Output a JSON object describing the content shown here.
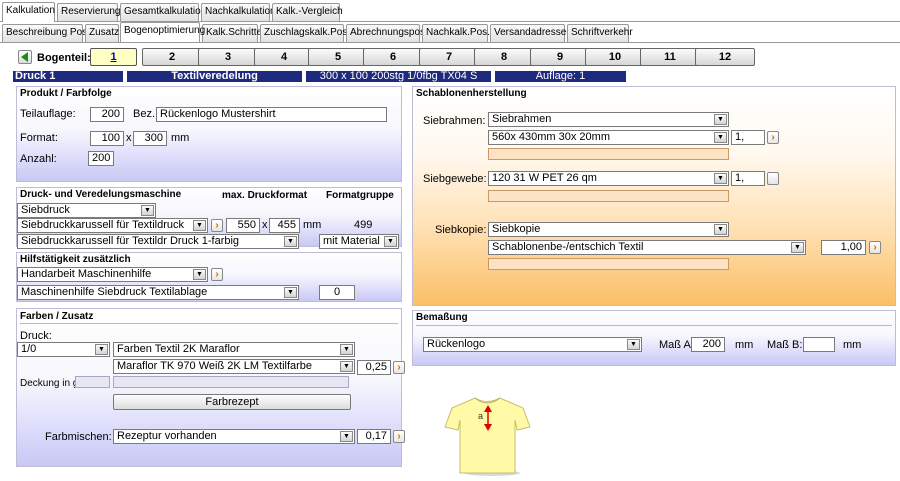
{
  "tabs_top": [
    "Kalkulation",
    "Reservierung",
    "Gesamtkalkulation",
    "Nachkalkulation",
    "Kalk.-Vergleich"
  ],
  "tabs_sub": [
    "Beschreibung Pos.",
    "Zusatz",
    "Bogenoptimierung",
    "Kalk.Schritte",
    "Zuschlagskalk.Pos.",
    "Abrechnungspos.",
    "Nachkalk.Pos.",
    "Versandadressen",
    "Schriftverkehr"
  ],
  "bogenteil": {
    "label": "Bogenteil:",
    "pages": [
      "1",
      "2",
      "3",
      "4",
      "5",
      "6",
      "7",
      "8",
      "9",
      "10",
      "11",
      "12"
    ],
    "active": "1"
  },
  "header": {
    "druck": "Druck 1",
    "veredelung": "Textilveredelung",
    "format_desc": "300 x 100 200stg 1/0fbg TX04 S",
    "auflage": "Auflage: 1"
  },
  "produkt": {
    "title": "Produkt / Farbfolge",
    "teilauflage_label": "Teilauflage:",
    "teilauflage": "200",
    "bez_label": "Bez.:",
    "bez": "Rückenlogo Mustershirt",
    "format_label": "Format:",
    "format_w": "100",
    "format_x": "x",
    "format_h": "300",
    "format_unit": "mm",
    "anzahl_label": "Anzahl:",
    "anzahl": "200"
  },
  "maschine": {
    "title": "Druck- und Veredelungsmaschine",
    "max_format_label": "max. Druckformat",
    "formatgruppe_label": "Formatgruppe",
    "verfahren": "Siebdruck",
    "maschine": "Siebdruckkarussell für Textildruck",
    "max_w": "550",
    "max_x": "x",
    "max_h": "455",
    "max_unit": "mm",
    "formatgruppe": "499",
    "variante": "Siebdruckkarussell für Textildr Druck 1-farbig",
    "material": "mit Material"
  },
  "hilfs": {
    "title": "Hilfstätigkeit zusätzlich",
    "item1": "Handarbeit Maschinenhilfe",
    "item2": "Maschinenhilfe Siebdruck Textilablage",
    "value": "0"
  },
  "farben": {
    "title": "Farben / Zusatz",
    "druck_label": "Druck:",
    "druck": "1/0",
    "farbsystem": "Farben Textil 2K Maraflor",
    "farbe": "Maraflor TK 970 Weiß 2K LM Textilfarbe",
    "farbe_value": "0,25",
    "deckung_label": "Deckung in g:",
    "farbrezept_btn": "Farbrezept",
    "farbmischen_label": "Farbmischen:",
    "farbmischen": "Rezeptur vorhanden",
    "farbmischen_value": "0,17"
  },
  "schablonen": {
    "title": "Schablonenherstellung",
    "siebrahmen_label": "Siebrahmen:",
    "siebrahmen": "Siebrahmen",
    "siebrahmen_size": "560x 430mm 30x 20mm",
    "siebrahmen_qty": "1,",
    "siebgewebe_label": "Siebgewebe:",
    "siebgewebe": "120 31 W PET 26 qm",
    "siebgewebe_qty": "1,",
    "siebkopie_label": "Siebkopie:",
    "siebkopie": "Siebkopie",
    "schablone": "Schablonenbe-/entschich Textil",
    "schablone_qty": "1,00"
  },
  "bemassung": {
    "title": "Bemaßung",
    "position": "Rückenlogo",
    "mass_a_label": "Maß A:",
    "mass_a": "200",
    "mass_a_unit": "mm",
    "mass_b_label": "Maß B:",
    "mass_b": "",
    "mass_b_unit": "mm"
  },
  "shirt_marker": "a",
  "colors": {
    "header_bar": "#1d2a7d",
    "accent_orange": "#d86800",
    "active_page_bg": "#ffffc4",
    "shirt": "#fff9a8"
  }
}
